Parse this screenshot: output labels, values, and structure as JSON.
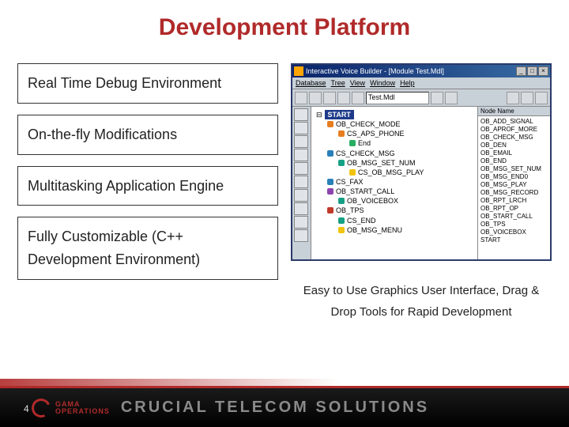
{
  "title": "Development Platform",
  "features": [
    "Real Time Debug Environment",
    "On-the-fly Modifications",
    "Multitasking Application Engine",
    "Fully Customizable (C++ Development Environment)"
  ],
  "app_window": {
    "title": "Interactive Voice Builder - [Module Test.Mdl]",
    "menus": [
      "Database",
      "Tree",
      "View",
      "Window",
      "Help"
    ],
    "filename": "Test.Mdl",
    "tree_root": "START",
    "tree_nodes": [
      {
        "indent": 1,
        "color": "d-orange",
        "label": "OB_CHECK_MODE"
      },
      {
        "indent": 2,
        "color": "d-orange",
        "label": "CS_APS_PHONE"
      },
      {
        "indent": 3,
        "color": "d-green",
        "label": "End"
      },
      {
        "indent": 1,
        "color": "d-blue",
        "label": "CS_CHECK_MSG"
      },
      {
        "indent": 2,
        "color": "d-teal",
        "label": "OB_MSG_SET_NUM"
      },
      {
        "indent": 3,
        "color": "d-yellow",
        "label": "CS_OB_MSG_PLAY"
      },
      {
        "indent": 1,
        "color": "d-blue",
        "label": "CS_FAX"
      },
      {
        "indent": 1,
        "color": "d-purple",
        "label": "OB_START_CALL"
      },
      {
        "indent": 2,
        "color": "d-teal",
        "label": "OB_VOICEBOX"
      },
      {
        "indent": 1,
        "color": "d-red",
        "label": "OB_TPS"
      },
      {
        "indent": 2,
        "color": "d-teal",
        "label": "CS_END"
      },
      {
        "indent": 2,
        "color": "d-yellow",
        "label": "OB_MSG_MENU"
      }
    ],
    "list_header": "Node Name",
    "list_items": [
      "OB_ADD_SIGNAL",
      "OB_APROF_MORE",
      "OB_CHECK_MSG",
      "OB_DEN",
      "OB_EMAIL",
      "OB_END",
      "OB_MSG_SET_NUM",
      "OB_MSG_END0",
      "OB_MSG_PLAY",
      "OB_MSG_RECORD",
      "OB_RPT_LRCH",
      "OB_RPT_OP",
      "OB_START_CALL",
      "OB_TPS",
      "OB_VOICEBOX",
      "START"
    ]
  },
  "caption": "Easy to Use Graphics User Interface, Drag & Drop Tools for Rapid Development",
  "footer": {
    "page": "4",
    "brand_top": "GAMA",
    "brand_bottom": "OPERATIONS",
    "tagline": "CRUCIAL TELECOM SOLUTIONS"
  }
}
